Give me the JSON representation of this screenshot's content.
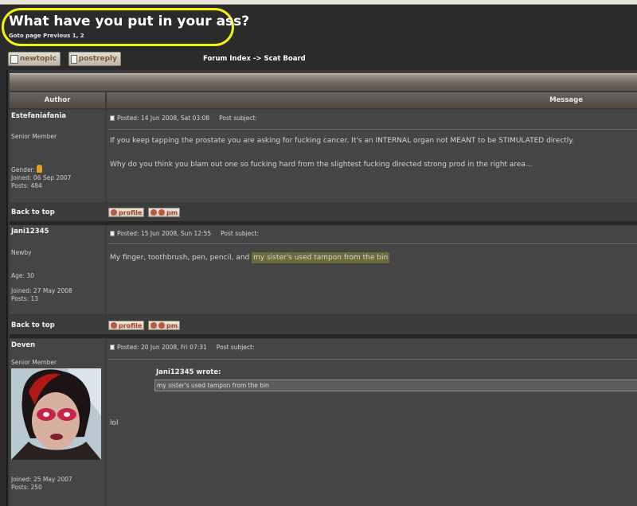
{
  "topic": {
    "title": "What have you put in your ass?",
    "goto": "Goto page Previous  1, 2"
  },
  "buttons": {
    "newtopic": "newtopic",
    "postreply": "postreply"
  },
  "breadcrumb": "Forum Index -> Scat Board",
  "columns": {
    "author": "Author",
    "message": "Message"
  },
  "row_actions": {
    "back_to_top": "Back to top",
    "profile": "profile",
    "pm": "pm"
  },
  "posts": [
    {
      "username": "Estefaniafania",
      "rank": "Senior Member",
      "gender_label": "Gender:",
      "joined": "Joined: 06 Sep 2007",
      "posts": "Posts: 484",
      "posted": "Posted: 14 Jun 2008, Sat 03:08",
      "subject_label": "Post subject:",
      "body_lines": [
        "If you keep tapping the prostate you are asking for fucking cancer. It's an INTERNAL organ not MEANT to be STIMULATED directly.",
        "Why do you think you blam out one so fucking hard from the slightest fucking directed strong prod in the right area..."
      ]
    },
    {
      "username": "Jani12345",
      "rank": "Newby",
      "age": "Age: 30",
      "joined": "Joined: 27 May 2008",
      "posts": "Posts: 13",
      "posted": "Posted: 15 Jun 2008, Sun 12:55",
      "subject_label": "Post subject:",
      "body_prefix": "My finger, toothbrush, pen, pencil, and ",
      "body_highlight": "my sister's used tampon from the bin"
    },
    {
      "username": "Deven",
      "rank": "Senior Member",
      "joined": "Joined: 25 May 2007",
      "posts": "Posts: 250",
      "posted": "Posted: 20 Jun 2008, Fri 07:31",
      "subject_label": "Post subject:",
      "quote_author": "Jani12345 wrote:",
      "quote_text": "my sister's used tampon from the bin",
      "body": "lol"
    }
  ],
  "colors": {
    "highlight_oval": "#f2f20a",
    "background": "#2b2b2b",
    "cell": "#454545"
  }
}
